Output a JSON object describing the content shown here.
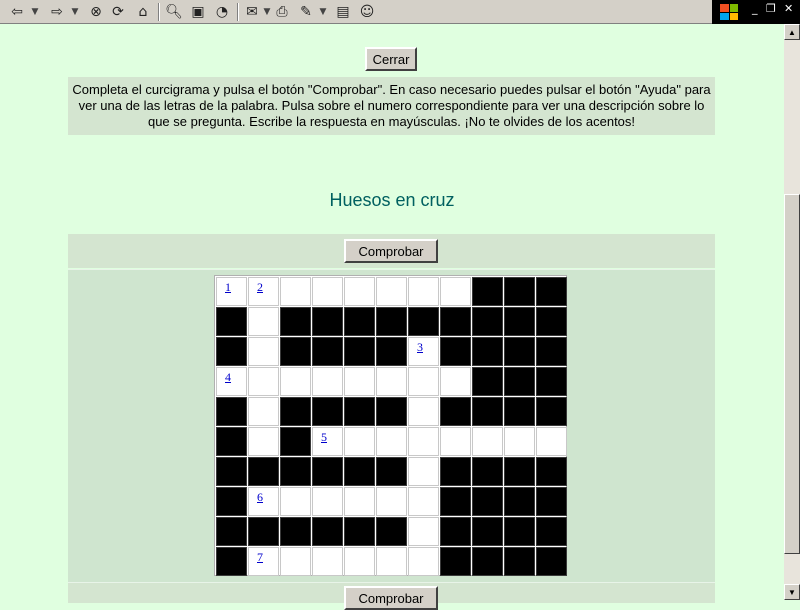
{
  "toolbar": {
    "icons": [
      "back-arrow-icon",
      "dropdown-icon",
      "forward-arrow-icon",
      "dropdown-icon",
      "stop-icon",
      "refresh-icon",
      "home-icon",
      "search-icon",
      "favorites-icon",
      "history-icon",
      "mail-icon",
      "dropdown-icon",
      "print-icon",
      "edit-icon",
      "dropdown-icon",
      "discuss-icon",
      "messenger-icon"
    ]
  },
  "page": {
    "close_label": "Cerrar",
    "instructions": "Completa el curcigrama y pulsa el botón \"Comprobar\". En caso necesario puedes pulsar el botón \"Ayuda\" para ver una de las letras de la palabra. Pulsa sobre el numero correspondiente para ver una descripción sobre lo que se pregunta. Escribe la respuesta en mayúsculas. ¡No te olvides de los acentos!",
    "title": "Huesos en cruz",
    "check_label": "Comprobar"
  },
  "crossword": {
    "rows": [
      "WWWWWWWWBBB",
      "BWBBBBBBBBB",
      "BWBBBBWBBBB",
      "WWWWWWWWBBB",
      "BWBBBBWBBBB",
      "BWBWWWWWWWW",
      "BBBBBBWBBBB",
      "BWWWWWWBBBB",
      "BBBBBBWBBBB",
      "BWWWWWWBBBB"
    ],
    "numbers": [
      {
        "row": 0,
        "col": 0,
        "label": "1"
      },
      {
        "row": 0,
        "col": 1,
        "label": "2"
      },
      {
        "row": 2,
        "col": 6,
        "label": "3"
      },
      {
        "row": 3,
        "col": 0,
        "label": "4"
      },
      {
        "row": 5,
        "col": 3,
        "label": "5"
      },
      {
        "row": 7,
        "col": 1,
        "label": "6"
      },
      {
        "row": 9,
        "col": 1,
        "label": "7"
      }
    ]
  }
}
